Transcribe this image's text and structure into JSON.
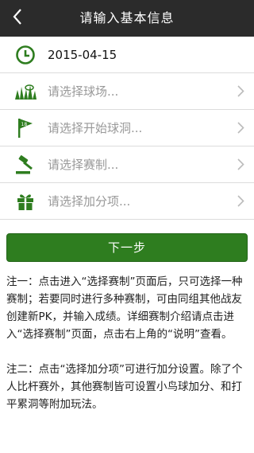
{
  "header": {
    "title": "请输入基本信息",
    "back_icon": "chevron-left-icon"
  },
  "date_row": {
    "icon": "clock-icon",
    "value": "2015-04-15"
  },
  "rows": [
    {
      "icon": "grass-icon",
      "label": "请选择球场..."
    },
    {
      "icon": "flag-18-icon",
      "label": "请选择开始球洞..."
    },
    {
      "icon": "gavel-icon",
      "label": "请选择赛制..."
    },
    {
      "icon": "gift-icon",
      "label": "请选择加分项..."
    }
  ],
  "next_button": {
    "label": "下一步"
  },
  "notes": {
    "note1": "注一：点击进入“选择赛制”页面后，只可选择一种赛制；若要同时进行多种赛制，可由同组其他战友创建新PK，并输入成绩。详细赛制介绍请点击进入“选择赛制”页面，点击右上角的“说明”查看。",
    "note2": "注二：点击“选择加分项”可进行加分设置。除了个人比杆赛外，其他赛制皆可设置小鸟球加分、和打平累洞等附加玩法。"
  },
  "colors": {
    "header_bg": "#2b2b2b",
    "accent_green": "#2e7d1f",
    "divider": "#dcdcdc"
  }
}
